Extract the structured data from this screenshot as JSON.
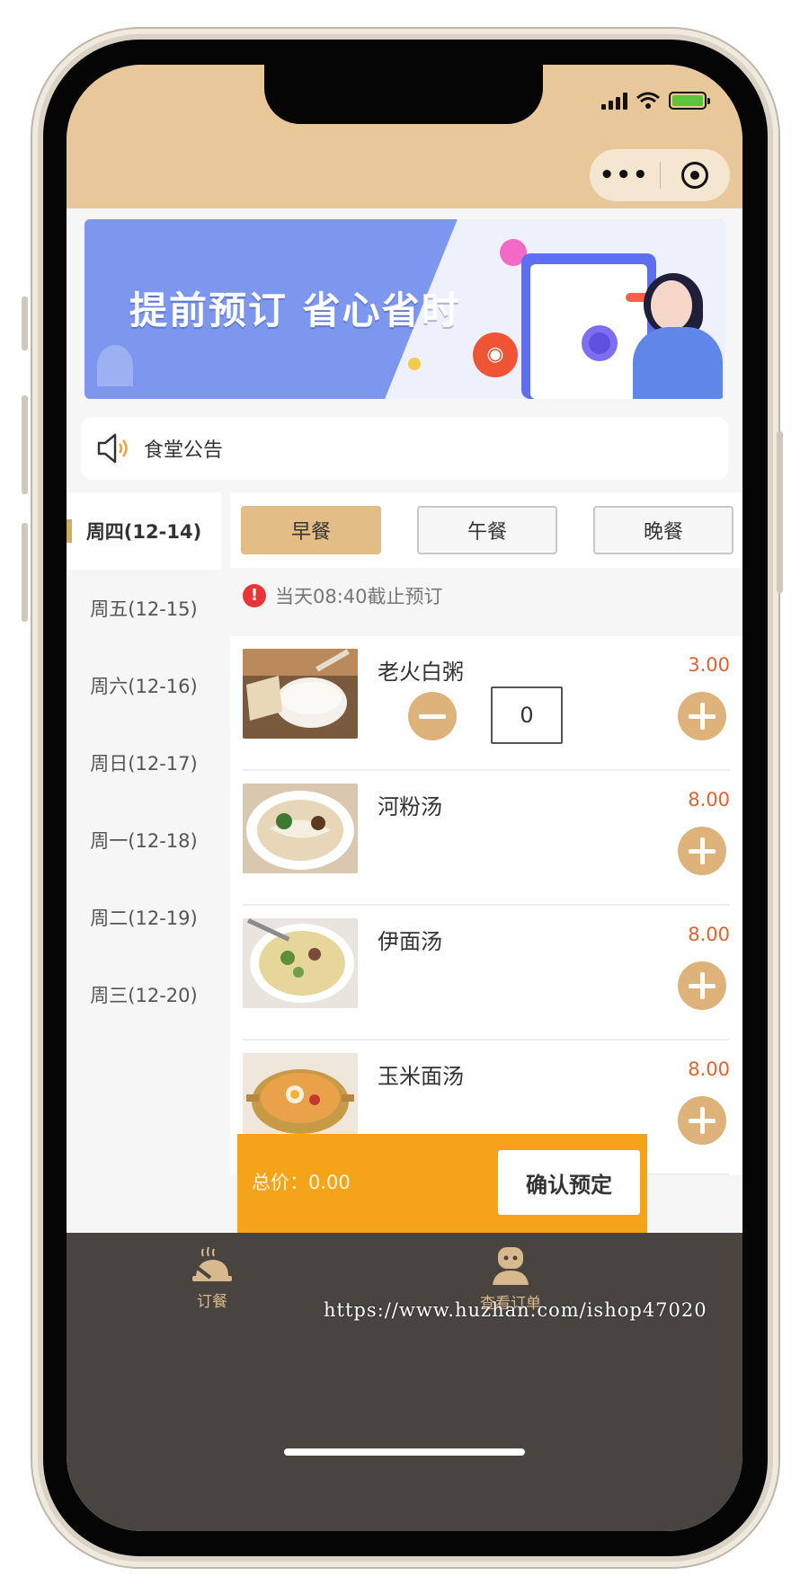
{
  "header": {
    "capsule_more": "•••"
  },
  "banner": {
    "title": "提前预订  省心省时"
  },
  "notice": {
    "label": "食堂公告"
  },
  "dates": [
    {
      "label": "周四(12-14)",
      "active": true
    },
    {
      "label": "周五(12-15)",
      "active": false
    },
    {
      "label": "周六(12-16)",
      "active": false
    },
    {
      "label": "周日(12-17)",
      "active": false
    },
    {
      "label": "周一(12-18)",
      "active": false
    },
    {
      "label": "周二(12-19)",
      "active": false
    },
    {
      "label": "周三(12-20)",
      "active": false
    }
  ],
  "meal_tabs": [
    {
      "label": "早餐",
      "active": true
    },
    {
      "label": "午餐",
      "active": false
    },
    {
      "label": "晚餐",
      "active": false
    }
  ],
  "deadline": {
    "icon": "!",
    "text": "当天08:40截止预订"
  },
  "foods": [
    {
      "name": "老火白粥",
      "price": "3.00",
      "quantity": "0",
      "image": "congee-photo"
    },
    {
      "name": "河粉汤",
      "price": "8.00",
      "image": "rice-noodle-soup-photo"
    },
    {
      "name": "伊面汤",
      "price": "8.00",
      "image": "yi-noodle-soup-photo"
    },
    {
      "name": "玉米面汤",
      "price": "8.00",
      "image": "corn-noodle-soup-photo"
    }
  ],
  "footer": {
    "total": "总价：0.00",
    "confirm": "确认预定"
  },
  "tabbar": [
    {
      "label": "订餐",
      "icon": "food-tray-icon"
    },
    {
      "label": "查看订单",
      "icon": "user-order-icon"
    }
  ],
  "watermark": "https://www.huzhan.com/ishop47020",
  "colors": {
    "header": "#e8c79a",
    "accent": "#ddb27b",
    "price": "#e0622e",
    "total_bar": "#f5a318",
    "tabbar": "#4a4440"
  }
}
